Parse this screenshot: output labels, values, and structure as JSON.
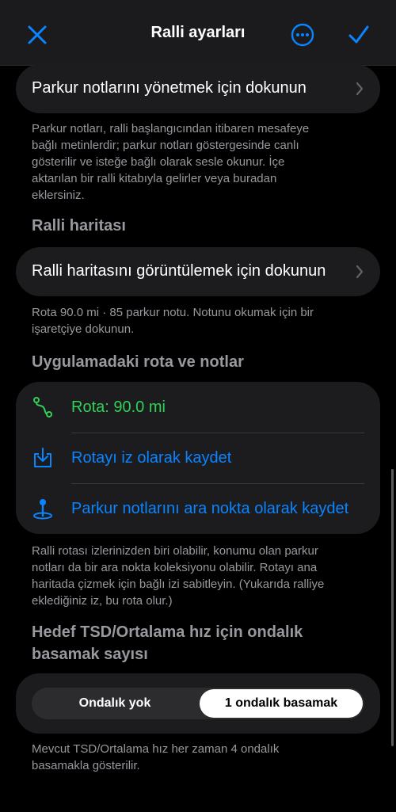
{
  "colors": {
    "accent": "#0a84ff",
    "route_green": "#30d158",
    "secondary_text": "#98989e"
  },
  "header": {
    "title": "Ralli ayarları",
    "close_icon": "close-icon",
    "more_icon": "ellipsis-circle-icon",
    "confirm_icon": "checkmark-icon"
  },
  "notes_row": {
    "label": "Parkur notlarını yönetmek için dokunun",
    "icon": "chevron-right-icon"
  },
  "notes_footnote": [
    "Parkur notları, ralli başlangıcından itibaren mesafeye",
    "bağlı metinlerdir; parkur notları göstergesinde canlı",
    "gösterilir ve isteğe bağlı olarak sesle okunur. İçe",
    "aktarılan bir ralli kitabıyla gelirler veya buradan",
    "eklersiniz."
  ],
  "map_section": {
    "header": "Ralli haritası",
    "row_label": "Ralli haritasını görüntülemek için dokunun",
    "footnote": [
      "Rota 90.0 mi · 85 parkur notu. Notunu okumak için bir",
      "işaretçiye dokunun."
    ]
  },
  "route_section": {
    "header": "Uygulamadaki rota ve notlar",
    "items": [
      {
        "label": "Rota: 90.0 mi",
        "icon": "route-icon"
      },
      {
        "label": "Rotayı iz olarak kaydet",
        "icon": "save-download-icon"
      },
      {
        "label": "Parkur notlarını ara nokta olarak kaydet",
        "icon": "map-pin-icon"
      }
    ],
    "footnote": [
      "Ralli rotası izlerinizden biri olabilir, konumu olan parkur",
      "notları da bir ara nokta koleksiyonu olabilir. Rotayı ana",
      "haritada çizmek için bağlı izi sabitleyin. (Yukarıda ralliye",
      "eklediğiniz iz, bu rota olur.)"
    ]
  },
  "decimal_section": {
    "header": [
      "Hedef TSD/Ortalama hız için ondalık",
      "basamak sayısı"
    ],
    "options": [
      "Ondalık yok",
      "1 ondalık basamak"
    ],
    "selected": "1 ondalık basamak",
    "footnote": [
      "Mevcut TSD/Ortalama hız her zaman 4 ondalık",
      "basamakla gösterilir."
    ]
  }
}
